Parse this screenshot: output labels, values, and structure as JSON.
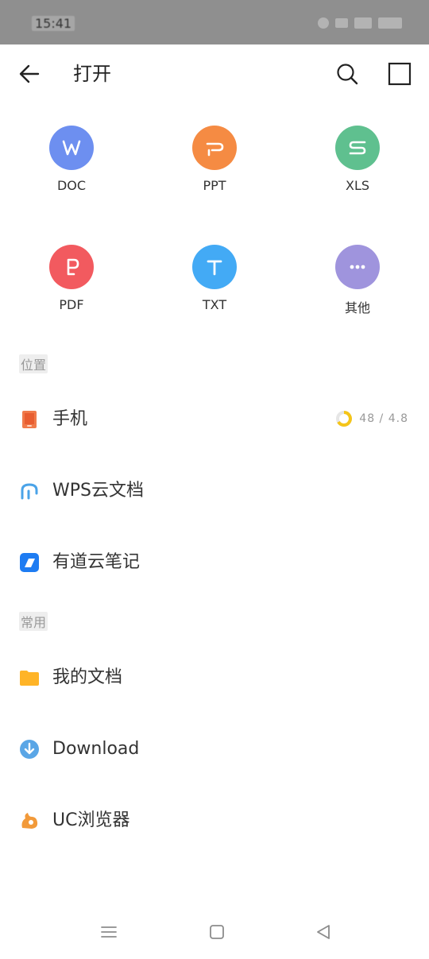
{
  "status_bar": {
    "time": "15:41"
  },
  "header": {
    "title": "打开"
  },
  "file_types": [
    {
      "label": "DOC",
      "glyph": "W",
      "color": "#6d8ff0"
    },
    {
      "label": "PPT",
      "glyph": "P",
      "color": "#f58b43"
    },
    {
      "label": "XLS",
      "glyph": "S",
      "color": "#5fc08f"
    },
    {
      "label": "PDF",
      "glyph": "P",
      "color": "#f25a5f"
    },
    {
      "label": "TXT",
      "glyph": "T",
      "color": "#43aaf5"
    },
    {
      "label": "其他",
      "glyph": "···",
      "color": "#9f94dd"
    }
  ],
  "sections": {
    "location": "位置",
    "recent": "常用"
  },
  "locations": [
    {
      "label": "手机",
      "icon": "phone-icon",
      "storage": "48 / 4.8"
    },
    {
      "label": "WPS云文档",
      "icon": "wps-cloud-icon"
    },
    {
      "label": "有道云笔记",
      "icon": "youdao-note-icon"
    }
  ],
  "recents": [
    {
      "label": "我的文档",
      "icon": "folder-icon"
    },
    {
      "label": "Download",
      "icon": "download-icon"
    },
    {
      "label": "UC浏览器",
      "icon": "uc-browser-icon"
    }
  ]
}
